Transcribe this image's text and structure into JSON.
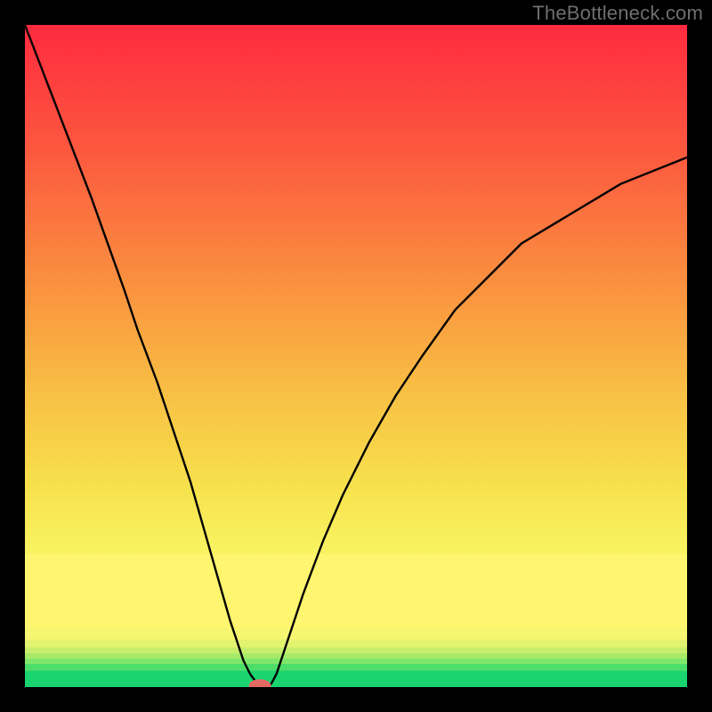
{
  "watermark": "TheBottleneck.com",
  "chart_data": {
    "type": "line",
    "title": "",
    "xlabel": "",
    "ylabel": "",
    "xlim": [
      0,
      100
    ],
    "ylim": [
      0,
      100
    ],
    "curve": {
      "x": [
        0,
        5,
        10,
        15,
        17,
        20,
        23,
        25,
        27,
        29,
        31,
        32,
        33,
        34,
        35,
        35.7,
        36.5,
        37.2,
        38,
        40,
        42,
        45,
        48,
        52,
        56,
        60,
        65,
        70,
        75,
        80,
        85,
        90,
        95,
        100
      ],
      "y": [
        100,
        87,
        74,
        60,
        54,
        46,
        37,
        31,
        24,
        17,
        10,
        7,
        4,
        2,
        0.6,
        0,
        0,
        0.5,
        2,
        8,
        14,
        22,
        29,
        37,
        44,
        50,
        57,
        62,
        67,
        70,
        73,
        76,
        78,
        80
      ]
    },
    "marker": {
      "x": 35.5,
      "y": 0.2,
      "r": 1.4,
      "color": "#e36a63"
    },
    "bottom_bands": [
      {
        "from": 0.0,
        "to": 2.5,
        "color": "#1ad56f"
      },
      {
        "from": 2.5,
        "to": 3.5,
        "color": "#4ddd6a"
      },
      {
        "from": 3.5,
        "to": 4.3,
        "color": "#7ee66a"
      },
      {
        "from": 4.3,
        "to": 5.1,
        "color": "#a6ea6a"
      },
      {
        "from": 5.1,
        "to": 6.0,
        "color": "#c6ee6c"
      },
      {
        "from": 6.0,
        "to": 7.2,
        "color": "#e4f36f"
      },
      {
        "from": 7.2,
        "to": 9.0,
        "color": "#f6f671"
      },
      {
        "from": 9.0,
        "to": 20.0,
        "color": "#fff56f"
      }
    ],
    "gradient_stops": [
      {
        "at": 100,
        "color": "#fe2a3f"
      },
      {
        "at": 80,
        "color": "#fc5b3f"
      },
      {
        "at": 60,
        "color": "#fa933f"
      },
      {
        "at": 45,
        "color": "#f8be44"
      },
      {
        "at": 30,
        "color": "#f7e24d"
      },
      {
        "at": 20,
        "color": "#f9f463"
      }
    ]
  },
  "frame": {
    "outer": 800,
    "margin": 28
  }
}
